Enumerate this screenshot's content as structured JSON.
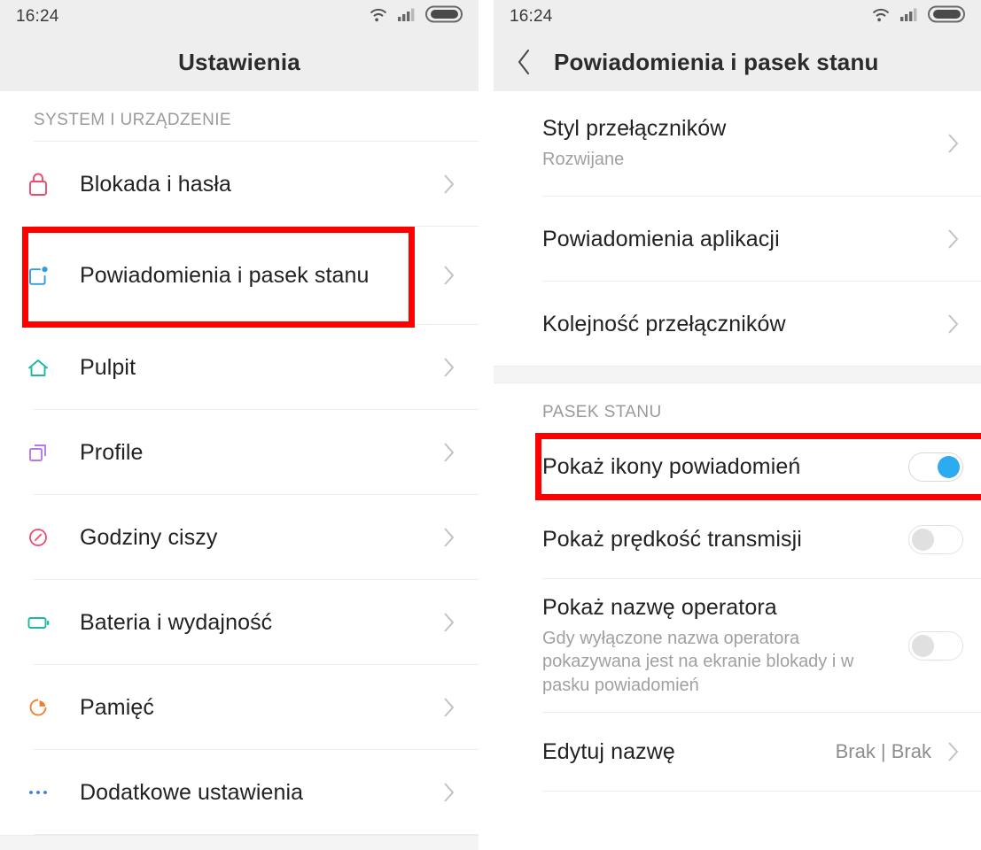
{
  "left_screen": {
    "status_bar": {
      "clock": "16:24",
      "icons": [
        "wifi-icon",
        "cellular-signal-icon",
        "battery-icon"
      ]
    },
    "app_bar": {
      "title": "Ustawienia"
    },
    "section_header": "SYSTEM I URZĄDZENIE",
    "items": [
      {
        "label": "Blokada i hasła",
        "icon": "lock-icon",
        "icon_color": "#f0496e",
        "chevron": "›"
      },
      {
        "label": "Powiadomienia i pasek stanu",
        "icon": "notification-badge-icon",
        "icon_color": "#2f9de0",
        "chevron": "›"
      },
      {
        "label": "Pulpit",
        "icon": "home-icon",
        "icon_color": "#1db8a0",
        "chevron": "›"
      },
      {
        "label": "Profile",
        "icon": "copy-windows-icon",
        "icon_color": "#b37af0",
        "chevron": "›"
      },
      {
        "label": "Godziny ciszy",
        "icon": "do-not-disturb-icon",
        "icon_color": "#f0496e",
        "chevron": "›"
      },
      {
        "label": "Bateria i wydajność",
        "icon": "battery-icon",
        "icon_color": "#1db8a0",
        "chevron": "›"
      },
      {
        "label": "Pamięć",
        "icon": "pie-chart-storage-icon",
        "icon_color": "#f08030",
        "chevron": "›"
      },
      {
        "label": "Dodatkowe ustawienia",
        "icon": "ellipsis-icon",
        "icon_color": "#2f7de0",
        "chevron": "›"
      }
    ],
    "highlight_color": "#fe0000"
  },
  "right_screen": {
    "status_bar": {
      "clock": "16:24",
      "icons": [
        "wifi-icon",
        "cellular-signal-icon",
        "battery-icon"
      ]
    },
    "app_bar": {
      "title": "Powiadomienia i pasek stanu",
      "back": "back-chevron-icon"
    },
    "items_top": [
      {
        "label": "Styl przełączników",
        "sub": "Rozwijane",
        "chevron": "›"
      },
      {
        "label": "Powiadomienia aplikacji",
        "sub": "",
        "chevron": "›"
      },
      {
        "label": "Kolejność przełączników",
        "sub": "",
        "chevron": "›"
      }
    ],
    "section_header": "PASEK STANU",
    "items_status": [
      {
        "label": "Pokaż ikony powiadomień",
        "sub": "",
        "toggle": "on"
      },
      {
        "label": "Pokaż prędkość transmisji",
        "sub": "",
        "toggle": "off"
      },
      {
        "label": "Pokaż nazwę operatora",
        "sub": "Gdy wyłączone nazwa operatora pokazywana jest na ekranie blokady i w pasku powiadomień",
        "toggle": "off"
      }
    ],
    "item_edit": {
      "label": "Edytuj nazwę",
      "value": "Brak | Brak",
      "chevron": "›"
    },
    "toggle_on_color": "#2cabf0",
    "toggle_off_color": "#e0e0e0",
    "highlight_color": "#fe0000"
  }
}
